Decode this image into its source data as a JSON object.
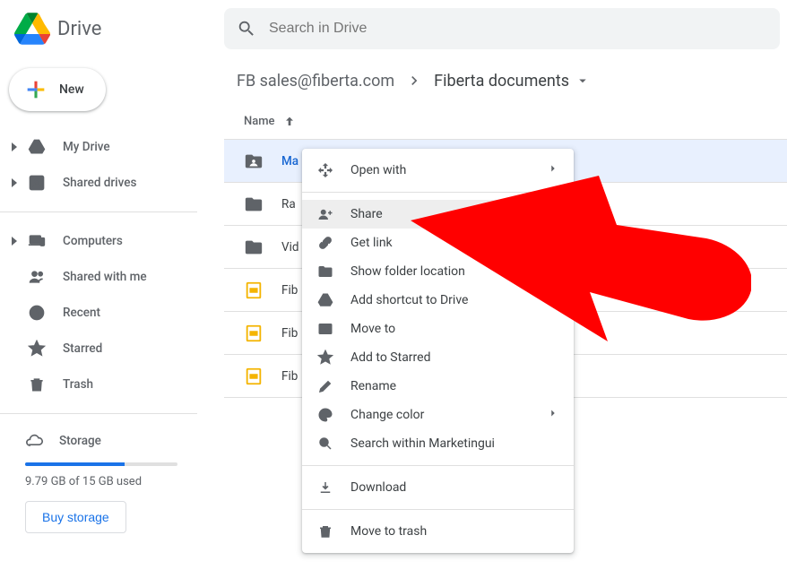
{
  "header": {
    "app_name": "Drive",
    "search_placeholder": "Search in Drive"
  },
  "new_button_label": "New",
  "sidebar": {
    "items": [
      {
        "label": "My Drive",
        "icon": "my-drive",
        "expandable": true
      },
      {
        "label": "Shared drives",
        "icon": "shared-drives",
        "expandable": true
      },
      {
        "label": "Computers",
        "icon": "computers",
        "expandable": true
      },
      {
        "label": "Shared with me",
        "icon": "shared-with-me",
        "expandable": false
      },
      {
        "label": "Recent",
        "icon": "recent",
        "expandable": false
      },
      {
        "label": "Starred",
        "icon": "starred",
        "expandable": false
      },
      {
        "label": "Trash",
        "icon": "trash",
        "expandable": false
      }
    ]
  },
  "storage": {
    "label": "Storage",
    "used_text": "9.79 GB of 15 GB used",
    "buy_label": "Buy storage",
    "percent": 65,
    "accent": "#1a73e8"
  },
  "breadcrumb": {
    "segments": [
      "FB sales@fiberta.com",
      "Fiberta documents"
    ]
  },
  "column_header": "Name",
  "sort_direction": "asc",
  "files": [
    {
      "name": "Ma",
      "kind": "shared-folder",
      "selected": true
    },
    {
      "name": "Ra",
      "kind": "folder",
      "selected": false
    },
    {
      "name": "Vid",
      "kind": "folder",
      "selected": false
    },
    {
      "name": "Fib",
      "kind": "slides",
      "selected": false
    },
    {
      "name": "Fib",
      "kind": "slides",
      "selected": false
    },
    {
      "name": "Fib",
      "kind": "slides",
      "selected": false
    }
  ],
  "context_menu": {
    "items": [
      {
        "label": "Open with",
        "icon": "open-with",
        "submenu": true
      },
      {
        "sep": true
      },
      {
        "label": "Share",
        "icon": "share",
        "hover": true
      },
      {
        "label": "Get link",
        "icon": "link"
      },
      {
        "label": "Show folder location",
        "icon": "folder-outline"
      },
      {
        "label": "Add shortcut to Drive",
        "icon": "shortcut"
      },
      {
        "label": "Move to",
        "icon": "move"
      },
      {
        "label": "Add to Starred",
        "icon": "star"
      },
      {
        "label": "Rename",
        "icon": "rename"
      },
      {
        "label": "Change color",
        "icon": "palette",
        "submenu": true
      },
      {
        "label": "Search within Marketingui",
        "icon": "search"
      },
      {
        "sep": true
      },
      {
        "label": "Download",
        "icon": "download"
      },
      {
        "sep": true
      },
      {
        "label": "Move to trash",
        "icon": "trash"
      }
    ]
  },
  "colors": {
    "folder": "#5f6368",
    "slides": "#f4b400",
    "selected_bg": "#e8f0fe",
    "selected_text": "#1967d2",
    "annotation_arrow": "#ff0000"
  }
}
